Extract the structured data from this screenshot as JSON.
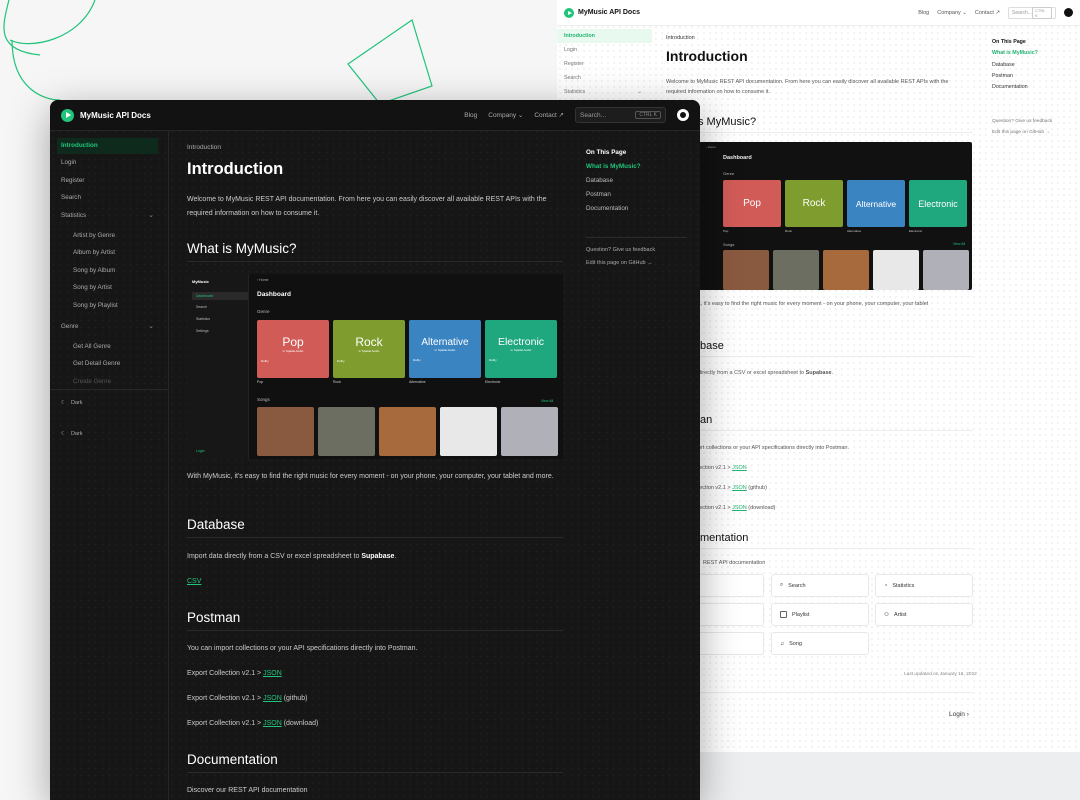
{
  "colors": {
    "accent": "#21c47a",
    "dark_bg": "#161616",
    "light_bg": "#ffffff"
  },
  "app": {
    "brand": "MyMusic API Docs"
  },
  "nav": {
    "blog": "Blog",
    "company": "Company",
    "contact": "Contact ↗",
    "search_placeholder": "Search...",
    "search_shortcut": "CTRL K",
    "github_icon": "github-icon"
  },
  "sidebar": {
    "items": [
      "Introduction",
      "Login",
      "Register",
      "Search",
      "Statistics"
    ],
    "statistics_sub": [
      "Artist by Genre",
      "Album by Artist",
      "Song by Album",
      "Song by Artist",
      "Song by Playlist"
    ],
    "genre": "Genre",
    "genre_sub": [
      "Get All Genre",
      "Get Detail Genre",
      "Create Genre"
    ],
    "theme": "Dark",
    "theme_bottom": "Dark"
  },
  "content": {
    "breadcrumb": "Introduction",
    "title": "Introduction",
    "intro": "Welcome to MyMusic REST API documentation. From here you can easily discover all available REST APIs with the required information on how to consume it.",
    "what_heading": "What is MyMusic?",
    "what_text": "With MyMusic, it's easy to find the right music for every moment - on your phone, your computer, your tablet and more.",
    "database_heading": "Database",
    "database_text_pre": "Import data directly from a CSV or excel spreadsheet to ",
    "database_text_bold": "Supabase",
    "database_text_post": ".",
    "csv_link": "CSV",
    "postman_heading": "Postman",
    "postman_text": "You can import collections or your API specifications directly into Postman.",
    "export_prefix": "Export Collection v2.1 > ",
    "export_link": "JSON",
    "export_github": " (github)",
    "export_download": " (download)",
    "documentation_heading": "Documentation",
    "documentation_text": "Discover our REST API documentation",
    "doc_cards": [
      "Search",
      "Statistics",
      "Playlist",
      "Artist",
      "Song"
    ],
    "last_updated": "Last updated on January 16, 2022",
    "next_link": "Login"
  },
  "light_fragments": {
    "what_text": "c, it's easy to find the right music for every moment - on your phone, your computer, your tablet",
    "what_heading": "s MyMusic?",
    "database_heading": "base",
    "database_text_pre": "directly from a CSV or excel spreadsheet to ",
    "postman_heading": "an",
    "postman_text": "ort collections or your API specifications directly into Postman.",
    "export_prefix": "lection v2.1 > ",
    "documentation_heading": "mentation",
    "documentation_text": "REST API documentation",
    "card_frag_1": "n",
    "card_frag_2": "e",
    "card_frag_3": "m"
  },
  "toc": {
    "title": "On This Page",
    "items": [
      "What is MyMusic?",
      "Database",
      "Postman",
      "Documentation"
    ],
    "feedback": "Question? Give us feedback",
    "edit": "Edit this page on GitHub →"
  },
  "dashboard": {
    "app": "MyMusic",
    "home": "Home",
    "title": "Dashboard",
    "genre_label": "Genre",
    "songs_label": "Songs",
    "view_all": "View All",
    "menu": [
      "Dashboard",
      "Search",
      "Statistics",
      "Settings"
    ],
    "login": "Login",
    "genres": [
      {
        "name": "Pop",
        "sub": "in Spatial Audio",
        "color": "#d15b57",
        "caption": "Pop"
      },
      {
        "name": "Rock",
        "sub": "in Spatial Audio",
        "color": "#7f9c2e",
        "caption": "Rock"
      },
      {
        "name": "Alternative",
        "sub": "in Spatial Audio",
        "color": "#3b84c2",
        "caption": "Alternative"
      },
      {
        "name": "Electronic",
        "sub": "in Spatial Audio",
        "color": "#1fa77d",
        "caption": "Electronic"
      }
    ],
    "dolby": "Dolby",
    "song_colors": [
      "#8a5a40",
      "#6d6e62",
      "#a66a3d",
      "#e8e8e8",
      "#b0b0b8"
    ]
  }
}
